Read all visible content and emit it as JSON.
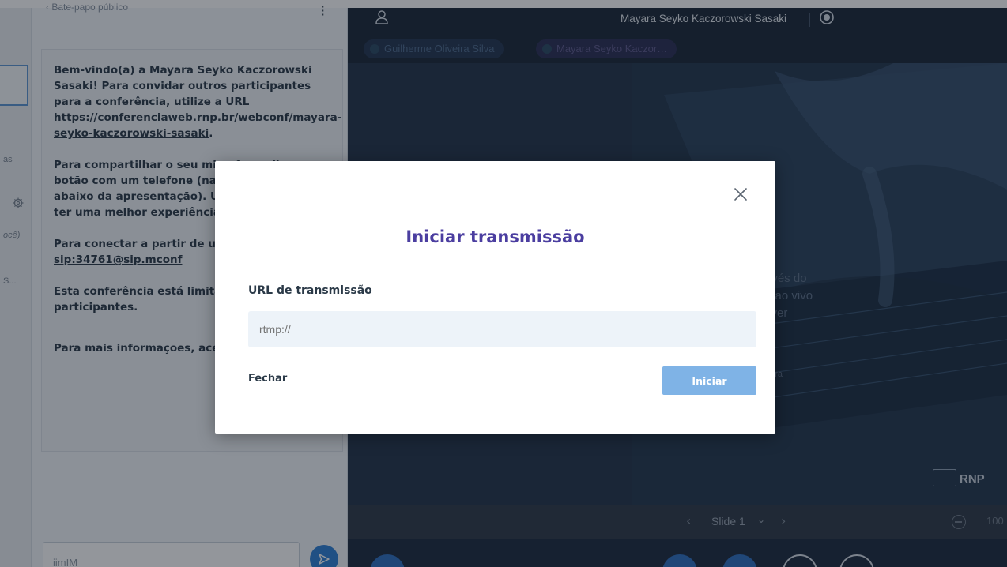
{
  "userlist": {
    "fragments": [
      {
        "text": "as",
        "italic": false
      },
      {
        "text": "ocê)",
        "italic": true
      },
      {
        "text": "S...",
        "italic": false
      }
    ]
  },
  "chat": {
    "header": "‹  Bate-papo público",
    "kebab": "⋮",
    "welcome": {
      "p1_before": "Bem-vindo(a) a Mayara Seyko Kaczorowski Sasaki! Para convidar outros participantes para a conferência, utilize a URL ",
      "p1_link": "https://conferenciaweb.rnp.br/webconf/mayara-seyko-kaczorowski-sasaki",
      "p1_after": ".",
      "p2": "Para compartilhar o seu microfone clique no botão com um telefone (na barra de ações abaixo da apresentação). Use um fone para ter uma melhor experiência e evitar ruídos.",
      "p3_before": "Para conectar a partir de um telefone, disque ",
      "p3_link": "sip:34761@sip.mconf",
      "p4": "Esta conferência está limitada a participantes.",
      "p5": "Para mais informações, acesse"
    },
    "input_placeholder": "iimIM"
  },
  "stage": {
    "title": "Mayara Seyko Kaczorowski Sasaki",
    "talkers": [
      "Guilherme Oliveira Silva",
      "Mayara Seyko Kaczor…"
    ],
    "slide_faint": [
      "avés do",
      "e ao vivo",
      "tiver",
      "para"
    ],
    "rnp_label": "RNP",
    "slide_nav": {
      "prev": "‹",
      "label": "Slide 1",
      "chevron": "⌄",
      "next": "›",
      "zoom_value": "100"
    }
  },
  "modal": {
    "title": "Iniciar transmissão",
    "url_label": "URL de transmissão",
    "url_placeholder": "rtmp://",
    "close_label": "Fechar",
    "start_label": "Iniciar"
  },
  "colors": {
    "accent_purple": "#4b3ea0",
    "primary_button": "#7fb3e6",
    "stage_bg": "#1d2b3e"
  }
}
